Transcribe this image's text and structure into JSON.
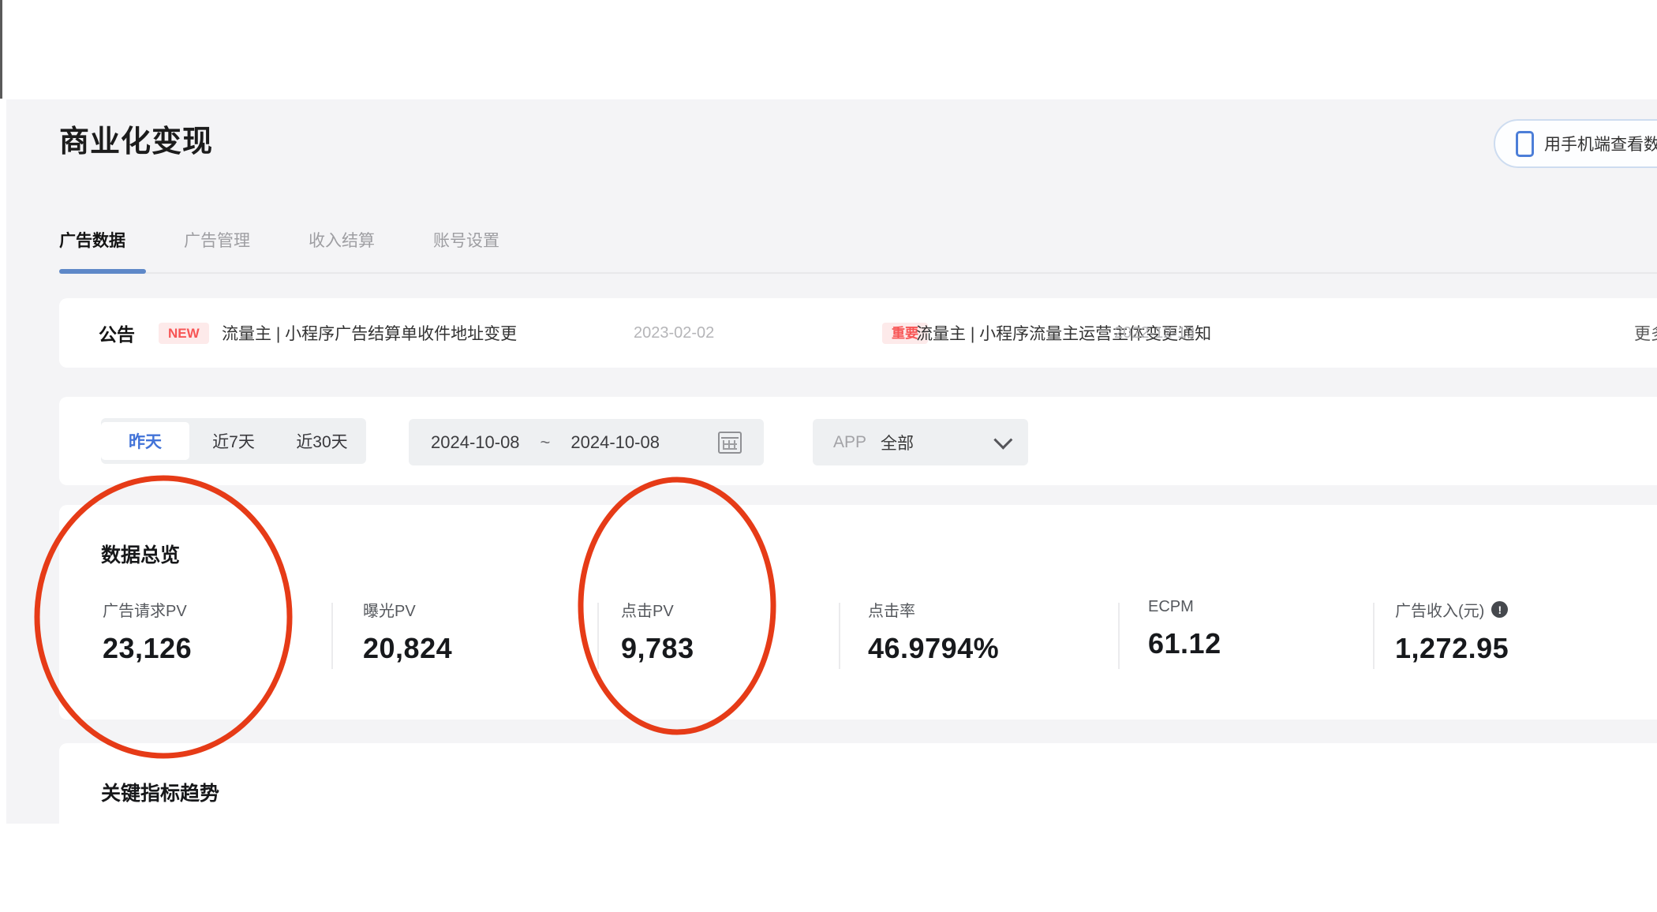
{
  "page": {
    "title": "商业化变现",
    "view_on_mobile_button": "用手机端查看数据"
  },
  "tabs": [
    {
      "label": "广告数据",
      "active": true
    },
    {
      "label": "广告管理",
      "active": false
    },
    {
      "label": "收入结算",
      "active": false
    },
    {
      "label": "账号设置",
      "active": false
    }
  ],
  "announcement": {
    "label": "公告",
    "items": [
      {
        "badge": "NEW",
        "text": "流量主 | 小程序广告结算单收件地址变更",
        "date": "2023-02-02"
      },
      {
        "badge": "重要",
        "text": "流量主 | 小程序流量主运营主体变更通知",
        "date": "2022-12-13"
      }
    ],
    "more": "更多"
  },
  "filters": {
    "quick_ranges": [
      {
        "label": "昨天",
        "selected": true
      },
      {
        "label": "近7天",
        "selected": false
      },
      {
        "label": "近30天",
        "selected": false
      }
    ],
    "date_start": "2024-10-08",
    "date_separator": "~",
    "date_end": "2024-10-08",
    "app_label": "APP",
    "app_value": "全部"
  },
  "overview": {
    "title": "数据总览",
    "info_glyph": "!",
    "metrics": [
      {
        "label": "广告请求PV",
        "value": "23,126",
        "circled": true
      },
      {
        "label": "曝光PV",
        "value": "20,824",
        "circled": false
      },
      {
        "label": "点击PV",
        "value": "9,783",
        "circled": true
      },
      {
        "label": "点击率",
        "value": "46.9794%",
        "circled": false
      },
      {
        "label": "ECPM",
        "value": "61.12",
        "circled": false
      },
      {
        "label": "广告收入(元)",
        "value": "1,272.95",
        "circled": false,
        "has_info_icon": true
      }
    ]
  },
  "trend": {
    "title": "关键指标趋势"
  },
  "icons": {
    "phone": "phone-icon",
    "calendar": "calendar-icon",
    "chevron_down": "chevron-down-icon",
    "info": "info-icon"
  },
  "colors": {
    "page_background": "#f4f4f6",
    "accent_blue": "#4273d8",
    "tab_underline_blue": "#5e88c8",
    "badge_red": "#f75555",
    "badge_background": "#fdeaea",
    "annotation_red": "#e63b17"
  }
}
